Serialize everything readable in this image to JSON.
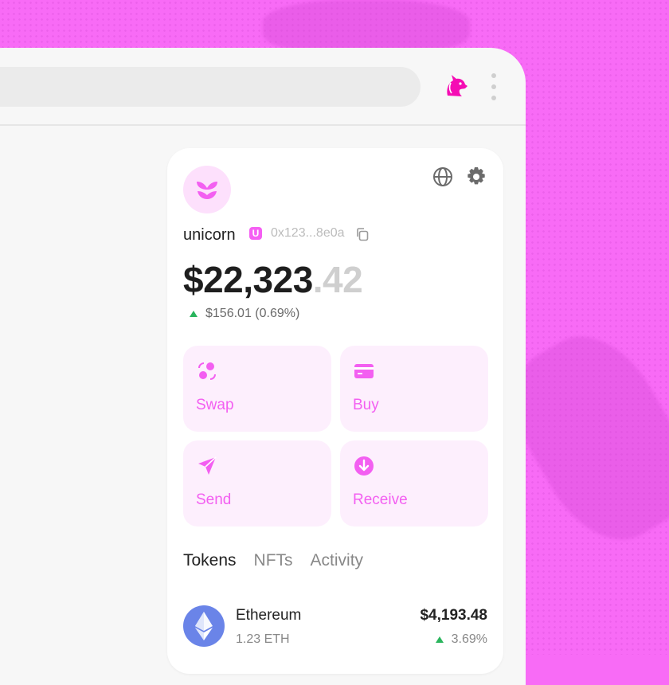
{
  "colors": {
    "accent": "#f35ff1",
    "background": "#f86bf6",
    "positive": "#2ab55d"
  },
  "browser": {
    "extension_icon": "unicorn-icon",
    "menu_icon": "kebab-menu-icon"
  },
  "wallet": {
    "avatar_icon": "wallet-avatar-icon",
    "header_icons": [
      "globe-icon",
      "gear-icon"
    ],
    "username": "unicorn",
    "badge": "U",
    "address": "0x123...8e0a",
    "balance_main": "$22,323",
    "balance_cents": ".42",
    "change": "$156.01 (0.69%)",
    "actions": [
      {
        "label": "Swap",
        "icon": "swap-icon"
      },
      {
        "label": "Buy",
        "icon": "card-icon"
      },
      {
        "label": "Send",
        "icon": "send-icon"
      },
      {
        "label": "Receive",
        "icon": "receive-icon"
      }
    ],
    "tabs": [
      "Tokens",
      "NFTs",
      "Activity"
    ],
    "tokens": [
      {
        "name": "Ethereum",
        "amount": "1.23 ETH",
        "value": "$4,193.48",
        "change": "3.69%",
        "icon": "ethereum-icon"
      }
    ]
  }
}
